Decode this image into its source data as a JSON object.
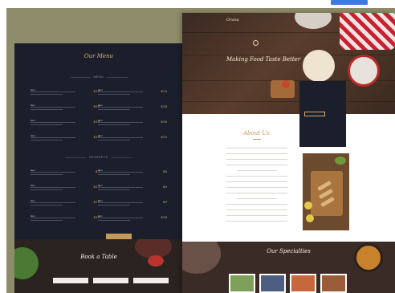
{
  "colors": {
    "backdrop": "#8e8c6a",
    "navy": "#1b1f2c",
    "gold": "#d0ad73",
    "wood": "#5a3d2c"
  },
  "menu_page": {
    "title": "Our Menu",
    "subtitle": "",
    "section1_label": "MENU",
    "section2_label": "DESSERTS",
    "items_section1": [
      {
        "name": "Item",
        "price": "$16"
      },
      {
        "name": "Item",
        "price": "$15"
      },
      {
        "name": "Item",
        "price": "$18"
      },
      {
        "name": "Item",
        "price": "$14"
      },
      {
        "name": "Item",
        "price": "$18"
      },
      {
        "name": "Item",
        "price": "$16"
      },
      {
        "name": "Item",
        "price": "$14"
      },
      {
        "name": "Item",
        "price": "$15"
      }
    ],
    "items_section2": [
      {
        "name": "Item",
        "price": "$7"
      },
      {
        "name": "Item",
        "price": "$8"
      },
      {
        "name": "Item",
        "price": "$12"
      },
      {
        "name": "Item",
        "price": "$9"
      },
      {
        "name": "Item",
        "price": "$11"
      },
      {
        "name": "Item",
        "price": "$9"
      },
      {
        "name": "Item",
        "price": "$14"
      },
      {
        "name": "Item",
        "price": "$14"
      }
    ],
    "button_label": ""
  },
  "book_section": {
    "title": "Book a Table",
    "subtitle": "",
    "fields": [
      "",
      "",
      ""
    ]
  },
  "site": {
    "logo": "Orana",
    "hero_title": "Making Food Taste Better",
    "hero_subtitle": "",
    "info_box": {
      "line1": "",
      "line2": "",
      "line3": "",
      "button": ""
    },
    "about_title": "About Us",
    "specialties_title": "Our Specialties",
    "specialties_subtitle": ""
  }
}
